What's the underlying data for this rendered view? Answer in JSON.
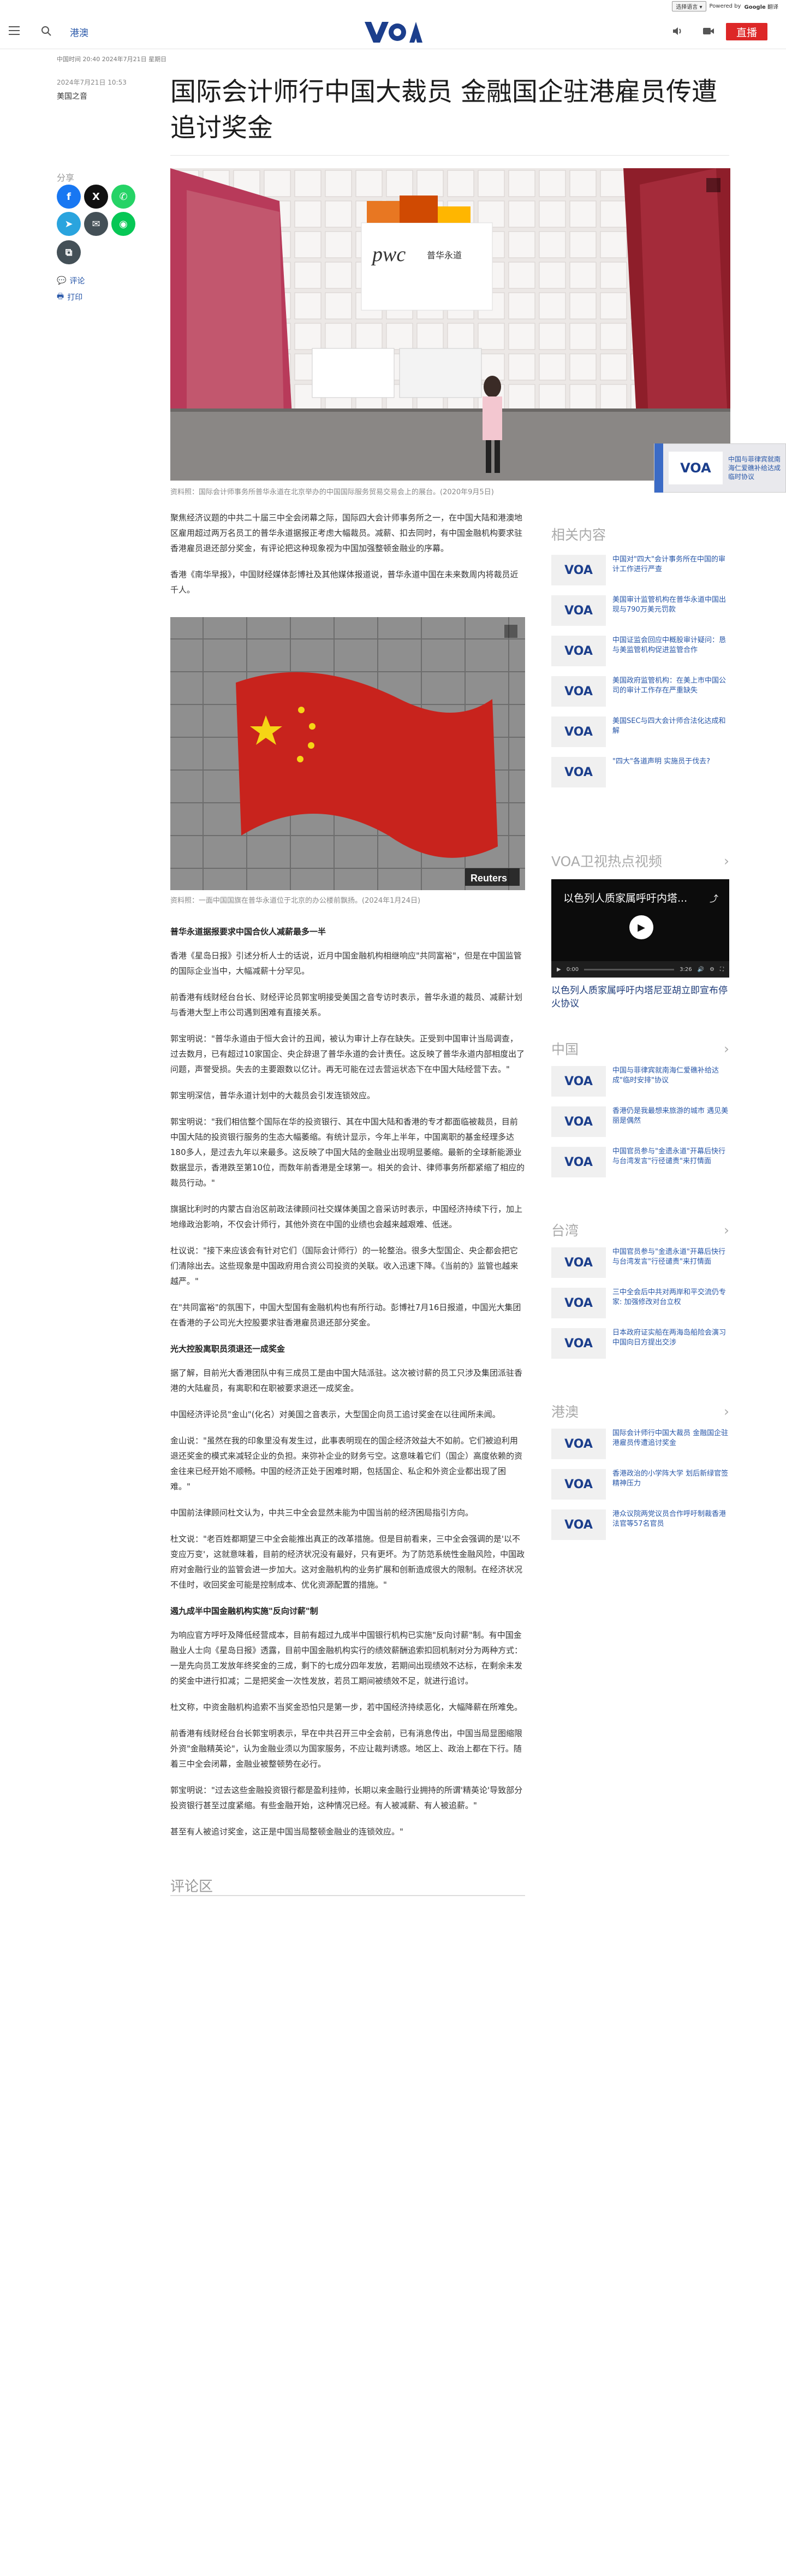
{
  "translate_bar": {
    "select_label": "选择语言",
    "powered_by": "Powered by",
    "google": "Google",
    "translate": "翻译"
  },
  "header": {
    "section": "港澳",
    "live": "直播"
  },
  "article": {
    "meta_top": "中国时间 20:40 2024年7月21日 星期日",
    "date": "2024年7月21日 10:53",
    "author": "美国之音",
    "title": "国际会计师行中国大裁员 金融国企驻港雇员传遭追讨奖金",
    "share_label": "分享",
    "comment_link": "评论",
    "print_link": "打印",
    "caption1": "资料照：国际会计师事务所普华永道在北京举办的中国国际服务贸易交易会上的展台。(2020年9月5日)",
    "paragraphs_1": [
      "聚焦经济议题的中共二十届三中全会闭幕之际，国际四大会计师事务所之一，在中国大陆和港澳地区雇用超过两万名员工的普华永道据报正考虑大幅裁员。减薪、扣去同时，有中国金融机构要求驻香港雇员退还部分奖金，有评论把这种现象视为中国加强整顿金融业的序幕。",
      "香港《南华早报》，中国财经媒体彭博社及其他媒体报道说，普华永道中国在未来数周内将裁员近千人。"
    ],
    "caption2": "资料照：一面中国国旗在普华永道位于北京的办公楼前飘扬。(2024年1月24日)",
    "section2": [
      {
        "heading": "普华永道据报要求中国合伙人减薪最多一半",
        "paras": [
          "香港《星岛日报》引述分析人士的话说，近月中国金融机构相继响应\"共同富裕\"，但是在中国监管的国际企业当中，大幅减薪十分罕见。",
          "前香港有线财经台台长、财经评论员郭宝明接受美国之音专访时表示，普华永道的裁员、减薪计划与香港大型上市公司遇到困难有直接关系。",
          "郭宝明说：\"普华永道由于恒大会计的丑闻，被认为审计上存在缺失。正受到中国审计当局调查，过去数月，已有超过10家国企、央企辞退了普华永道的会计责任。这反映了普华永道内部相度出了问题，声誉受损。失去的主要跟数以亿计。再无可能在过去营运状态下在中国大陆经营下去。\"",
          "郭宝明深信，普华永道计划中的大裁员会引发连锁效应。",
          "郭宝明说：\"我们相信整个国际在华的投资银行、其在中国大陆和香港的专才都面临被裁员，目前中国大陆的投资银行服务的生态大幅萎缩。有统计显示，今年上半年，中国离职的基金经理多达180多人，是过去九年以来最多。这反映了中国大陆的金融业出现明显萎缩。最新的全球新能源业数据显示，香港跌至第10位，而数年前香港是全球第一。相关的会计、律师事务所都紧缩了相应的裁员行动。\"",
          "旗据比利时的内蒙古自治区前政法律顾问社交媒体美国之音采访时表示，中国经济持续下行，加上地缘政治影响，不仅会计师行，其他外资在中国的业绩也会越来越艰难、低迷。",
          "杜议说：\"接下来应该会有针对它们（国际会计师行）的一轮整治。很多大型国企、央企都会把它们清除出去。这些现象是中国政府用合资公司投资的关联。收入迅速下降。《当前的》监管也越来越严。\"",
          "在\"共同富裕\"的氛围下，中国大型国有金融机构也有所行动。彭博社7月16日报道，中国光大集团在香港的子公司光大控股要求驻香港雇员退还部分奖金。"
        ]
      },
      {
        "heading": "光大控股离职员须退还一成奖金",
        "paras": [
          "据了解，目前光大香港团队中有三成员工是由中国大陆派驻。这次被讨薪的员工只涉及集团派驻香港的大陆雇员，有离职和在职被要求退还一成奖金。",
          "中国经济评论员\"金山\"(化名）对美国之音表示，大型国企向员工追讨奖金在以往闻所未闻。",
          "金山说：\"虽然在我的印象里没有发生过，此事表明现在的国企经济效益大不如前。它们被迫利用退还奖金的模式来减轻企业的负担。来弥补企业的财务亏空。这意味着它们（国企）高度依赖的资金往来已经开始不顺畅。中国的经济正处于困难时期，包括国企、私企和外资企业都出现了困难。\"",
          "中国前法律顾问杜文认为，中共三中全会显然未能为中国当前的经济困局指引方向。",
          "杜文说：\"老百姓都期望三中全会能推出真正的改革措施。但是目前看来，三中全会强调的是'以不变应万变'，这就意味着，目前的经济状况没有最好，只有更坏。为了防范系统性金融风险，中国政府对金融行业的监管会进一步加大。这对金融机构的业务扩展和创新造成很大的限制。在经济状况不佳时，收回奖金可能是控制成本、优化资源配置的措施。\""
        ]
      },
      {
        "heading": "遏九成半中国金融机构实施\"反向讨薪\"制",
        "paras": [
          "为响应官方呼吁及降低经营成本，目前有超过九成半中国银行机构已实施\"反向讨薪\"制。有中国金融业人士向《星岛日报》透露，目前中国金融机构实行的绩效薪酬追索扣回机制对分为两种方式：一是先向员工发放年终奖金的三成，剩下的七成分四年发放，若期间出现绩效不达标，在剩余未发的奖金中进行扣减；二是把奖金一次性发放，若员工期间被绩效不足，就进行追讨。",
          "杜文称，中资金融机构追索不当奖金恐怕只是第一步，若中国经济持续恶化，大幅降薪在所难免。",
          "前香港有线财经台台长郭宝明表示，早在中共召开三中全会前，已有消息传出，中国当局显图缩限外资\"金融精英论\"，认为金融业须以为国家服务，不应让裁判诱惑。地区上、政治上都在下行。随着三中全会闭幕，金融业被整顿势在必行。",
          "郭宝明说：\"过去这些金融投资银行都是盈利挂帅，长期以来金融行业拥持的所谓'精英论'导致部分投资银行甚至过度紧缩。有些金融开始，这种情况已经。有人被减薪、有人被追薪。\"",
          "甚至有人被追讨奖金，这正是中国当局整顿金融业的连锁效应。\""
        ]
      }
    ],
    "comments_label": "评论区"
  },
  "popup": {
    "text": "中国与菲律宾就南海仁爱礁补给达成临时协议"
  },
  "related": {
    "title": "相关内容",
    "items": [
      "中国对\"四大\"会计事务所在中国的审计工作进行严查",
      "美国审计监管机构在普华永道中国出现与790万美元罚款",
      "中国证监会回应中概股审计疑问：恳与美监管机构促进监管合作",
      "美国政府监管机构：在美上市中国公司的审计工作存在严重缺失",
      "美国SEC与四大会计师合法化达成和解",
      "\"四大\"各道声明 实施员于伐去?"
    ]
  },
  "video_rail": {
    "title": "VOA卫视热点视频",
    "video_title": "以色列人质家属呼吁内塔尼亚胡立即宣布停火协议",
    "overlay_title": "以色列人质家属呼吁内塔...",
    "time_current": "0:00",
    "time_total": "3:26"
  },
  "china": {
    "title": "中国",
    "items": [
      "中国与菲律宾就南海仁爱礁补给达成\"临时安排\"协议",
      "香港仍是我最想来旅游的城市 遇见美丽是偶然",
      "中国官员参与\"金遗永道\"开幕后快行 与台湾发言\"行径谴责\"来打情面"
    ]
  },
  "taiwan": {
    "title": "台湾",
    "items": [
      "中国官员参与\"金遗永道\"开幕后快行 与台湾发言\"行径谴责\"来打情面",
      "三中全会后中共对两岸和平交流仍专家: 加强修改对台立权",
      "日本政府证实船在两海岛船险会演习 中国向日方提出交涉"
    ]
  },
  "hk": {
    "title": "港澳",
    "items": [
      "国际会计师行中国大裁员 金融国企驻港雇员传遭追讨奖金",
      "香港政治的小学阵大学 划后新绿官签精神压力",
      "港众议院两党议员合作呼吁制裁香港法官等57名官员"
    ]
  }
}
